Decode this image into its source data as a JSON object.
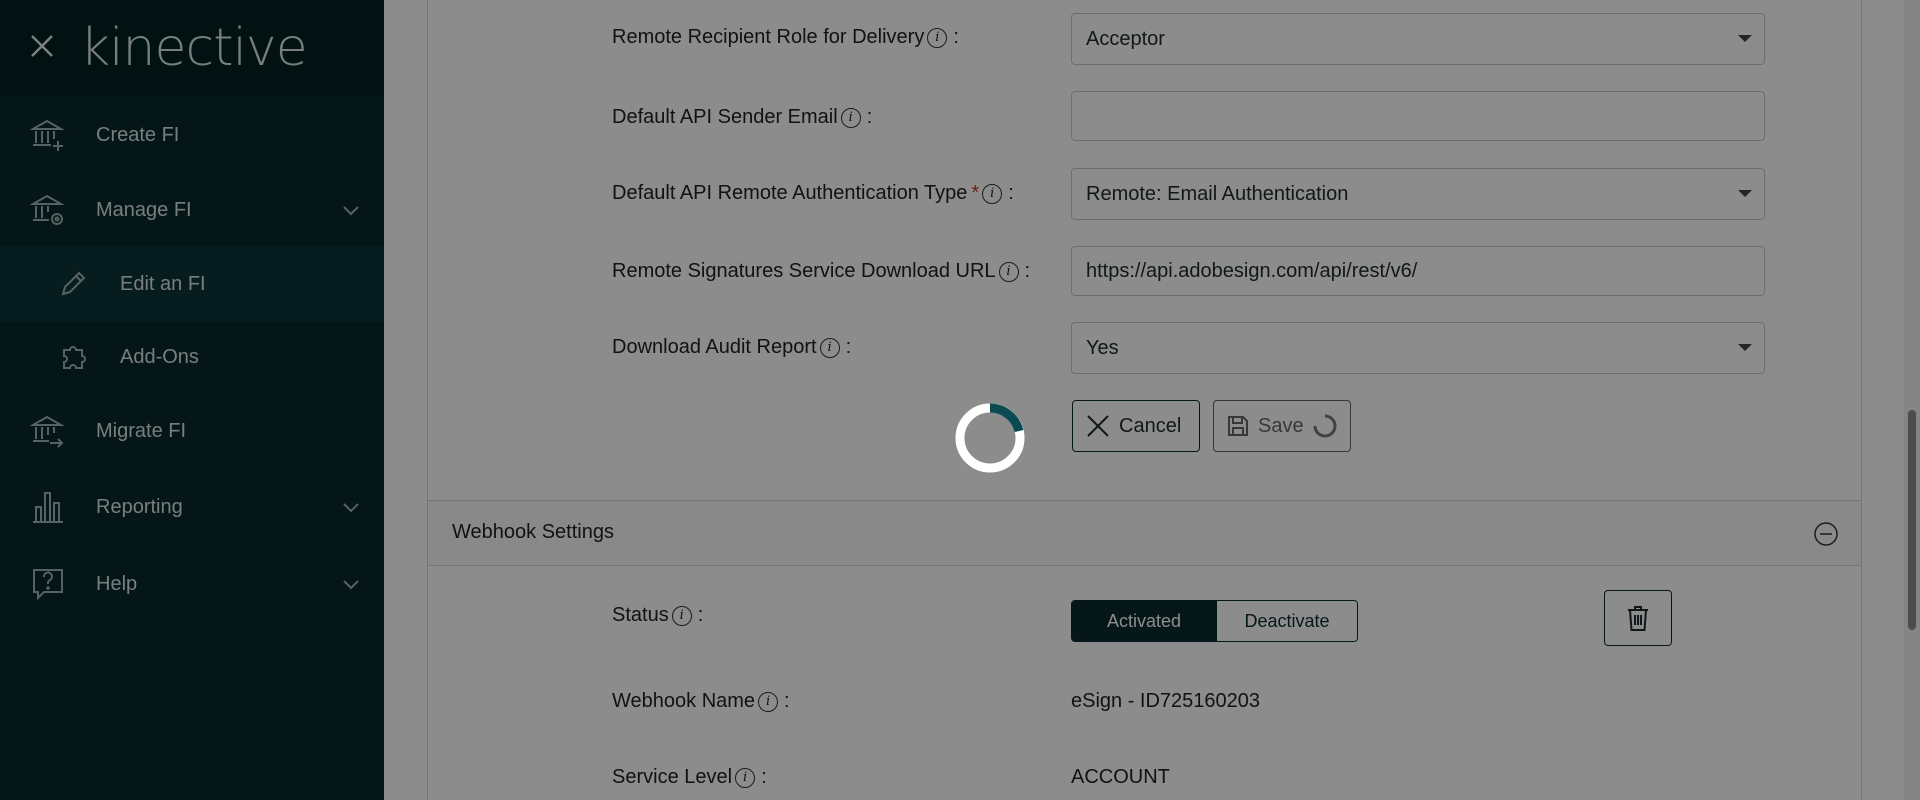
{
  "sidebar": {
    "logo": "kinective",
    "items": [
      {
        "label": "Create FI",
        "icon": "bank-plus-icon"
      },
      {
        "label": "Manage FI",
        "icon": "bank-gear-icon"
      },
      {
        "label": "Edit an FI",
        "icon": "pencil-icon"
      },
      {
        "label": "Add-Ons",
        "icon": "puzzle-icon"
      },
      {
        "label": "Migrate FI",
        "icon": "bank-arrow-icon"
      },
      {
        "label": "Reporting",
        "icon": "bar-chart-icon"
      },
      {
        "label": "Help",
        "icon": "help-bubble-icon"
      }
    ]
  },
  "form": {
    "fields": [
      {
        "label": "Remote Recipient Role for Delivery",
        "value": "Acceptor",
        "type": "select",
        "required": false
      },
      {
        "label": "Default API Sender Email",
        "value": "",
        "type": "input",
        "required": false
      },
      {
        "label": "Default API Remote Authentication Type",
        "value": "Remote: Email Authentication",
        "type": "select",
        "required": true
      },
      {
        "label": "Remote Signatures Service Download URL",
        "value": "https://api.adobesign.com/api/rest/v6/",
        "type": "input",
        "required": false
      },
      {
        "label": "Download Audit Report",
        "value": "Yes",
        "type": "select",
        "required": false
      }
    ],
    "colon": ":",
    "required_mark": "*",
    "cancel_label": "Cancel",
    "save_label": "Save"
  },
  "webhook": {
    "section_title": "Webhook Settings",
    "status_label": "Status",
    "status_options": [
      "Activated",
      "Deactivate"
    ],
    "status_selected": "Activated",
    "name_label": "Webhook Name",
    "name_value": "eSign - ID725160203",
    "service_level_label": "Service Level",
    "service_level_value": "ACCOUNT"
  },
  "colors": {
    "sidebar_bg": "#08282b",
    "accent": "#0b2b2e",
    "spinner": "#0b4a50"
  }
}
